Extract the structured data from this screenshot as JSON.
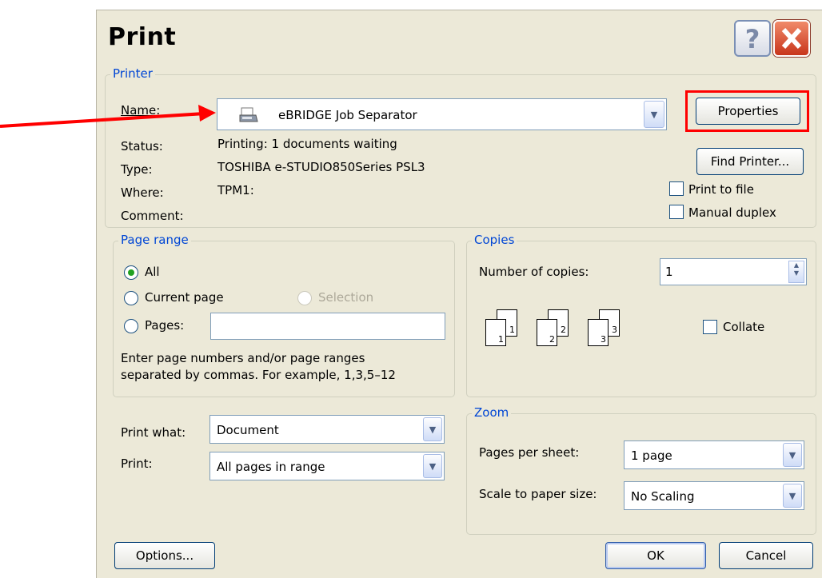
{
  "window": {
    "title": "Print"
  },
  "titlebar": {
    "help_label": "?"
  },
  "printer": {
    "group_label": "Printer",
    "name_label": "Name:",
    "name_value": "eBRIDGE Job Separator",
    "status_label": "Status:",
    "status_value": "Printing: 1 documents waiting",
    "type_label": "Type:",
    "type_value": "TOSHIBA e-STUDIO850Series PSL3",
    "where_label": "Where:",
    "where_value": "TPM1:",
    "comment_label": "Comment:",
    "comment_value": "",
    "properties_label": "Properties",
    "find_printer_label": "Find Printer...",
    "print_to_file_label": "Print to file",
    "manual_duplex_label": "Manual duplex",
    "print_to_file_checked": false,
    "manual_duplex_checked": false
  },
  "page_range": {
    "group_label": "Page range",
    "all_label": "All",
    "current_page_label": "Current page",
    "selection_label": "Selection",
    "pages_label": "Pages:",
    "pages_value": "",
    "selected": "All",
    "hint_line1": "Enter page numbers and/or page ranges",
    "hint_line2": "separated by commas.  For example, 1,3,5–12"
  },
  "copies": {
    "group_label": "Copies",
    "number_label": "Number of copies:",
    "number_value": "1",
    "collate_label": "Collate",
    "collate_checked": false,
    "pages_icon": [
      "1",
      "1",
      "2",
      "2",
      "3",
      "3"
    ]
  },
  "print_what": {
    "label": "Print what:",
    "value": "Document"
  },
  "print": {
    "label": "Print:",
    "value": "All pages in range"
  },
  "zoom": {
    "group_label": "Zoom",
    "pages_per_sheet_label": "Pages per sheet:",
    "pages_per_sheet_value": "1 page",
    "scale_label": "Scale to paper size:",
    "scale_value": "No Scaling"
  },
  "footer": {
    "options_label": "Options...",
    "ok_label": "OK",
    "cancel_label": "Cancel"
  },
  "annotation": {
    "arrow_color": "#ff0000",
    "highlight_color": "#ff0000"
  }
}
